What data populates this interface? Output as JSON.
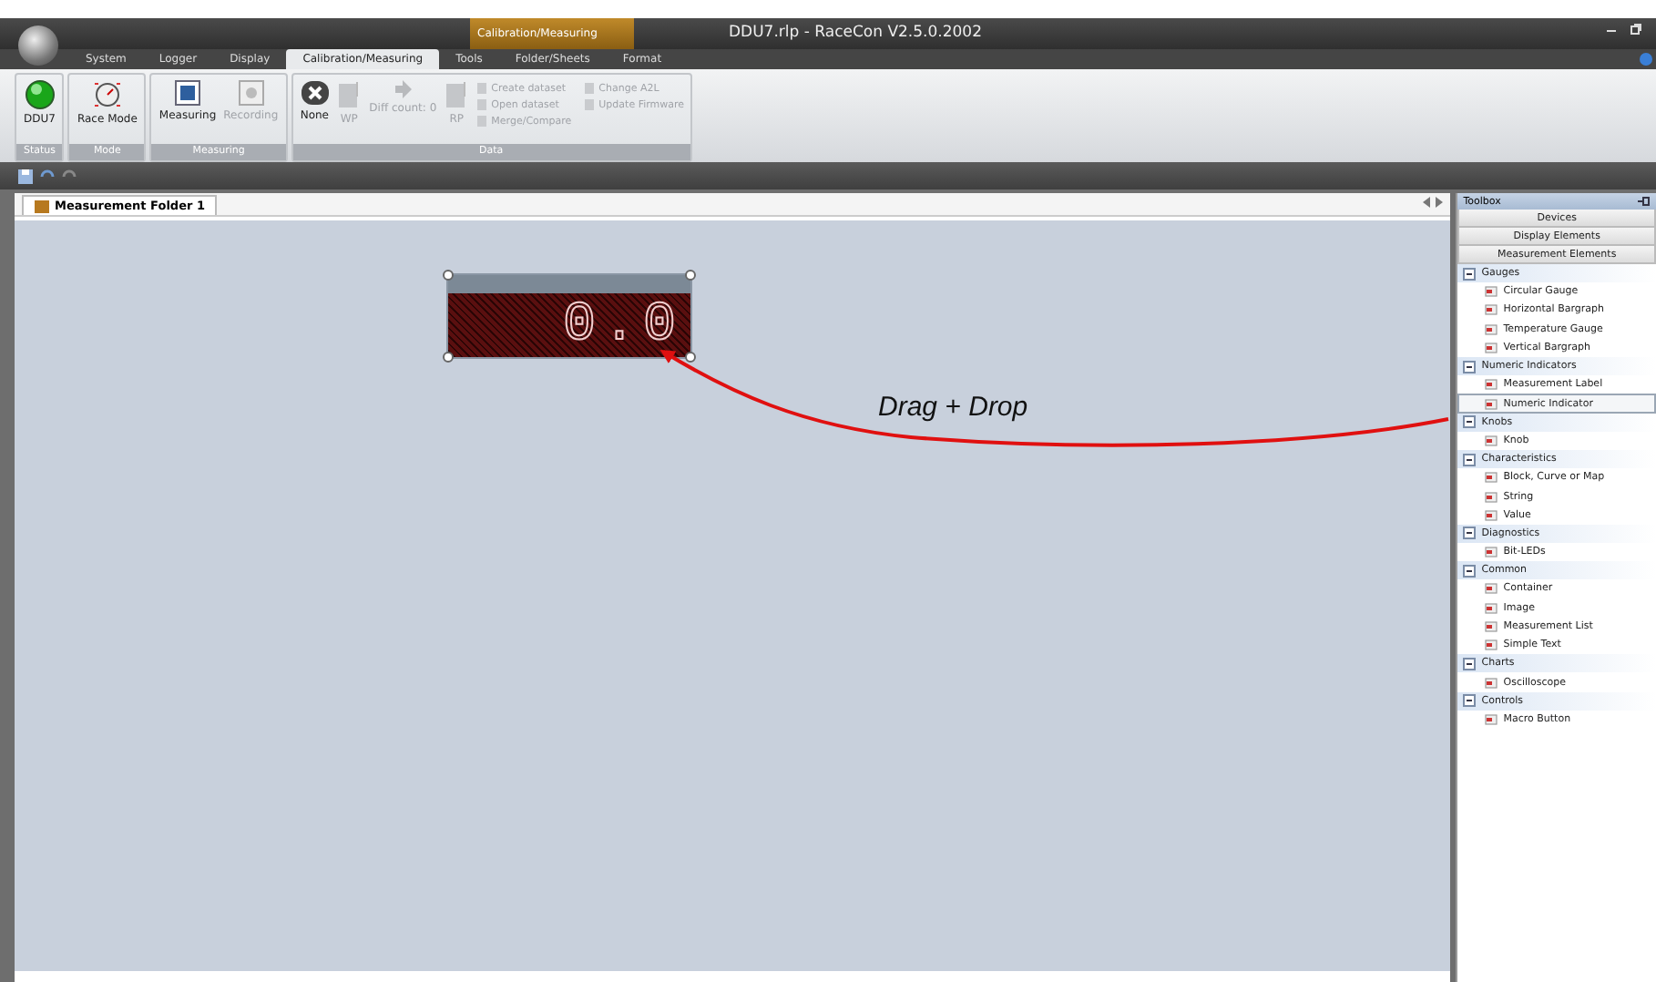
{
  "window": {
    "title": "DDU7.rlp - RaceCon V2.5.0.2002",
    "contextual_tab_group": "Calibration/Measuring"
  },
  "tabs": [
    {
      "label": "System",
      "selected": false
    },
    {
      "label": "Logger",
      "selected": false
    },
    {
      "label": "Display",
      "selected": false
    },
    {
      "label": "Calibration/Measuring",
      "selected": true
    },
    {
      "label": "Tools",
      "selected": false
    },
    {
      "label": "Folder/Sheets",
      "selected": false
    },
    {
      "label": "Format",
      "selected": false
    }
  ],
  "ribbon": [
    {
      "group": "Status",
      "buttons": [
        {
          "label": "DDU7",
          "kind": "led",
          "disabled": false
        }
      ]
    },
    {
      "group": "Mode",
      "buttons": [
        {
          "label": "Race Mode",
          "kind": "gauge",
          "disabled": false
        }
      ]
    },
    {
      "group": "Measuring",
      "buttons": [
        {
          "label": "Measuring",
          "kind": "square",
          "disabled": false
        },
        {
          "label": "Recording",
          "kind": "record",
          "disabled": true
        }
      ]
    },
    {
      "group": "Data",
      "buttons": [
        {
          "label": "None",
          "kind": "none",
          "disabled": false
        },
        {
          "label": "WP",
          "kind": "page",
          "disabled": true
        },
        {
          "label": "Diff count: 0",
          "kind": "diff",
          "disabled": true
        },
        {
          "label": "RP",
          "kind": "page",
          "disabled": true
        }
      ],
      "small_buttons": [
        {
          "label": "Create dataset",
          "disabled": true
        },
        {
          "label": "Open dataset",
          "disabled": true
        },
        {
          "label": "Merge/Compare",
          "disabled": true
        },
        {
          "label": "Change A2L",
          "disabled": true
        },
        {
          "label": "Update Firmware",
          "disabled": true
        }
      ]
    }
  ],
  "document_tab": {
    "label": "Measurement Folder 1"
  },
  "canvas": {
    "display_value": "0.0",
    "annotation": "Drag + Drop"
  },
  "toolbox": {
    "title": "Toolbox",
    "sections": [
      "Devices",
      "Display Elements",
      "Measurement Elements"
    ],
    "categories": [
      {
        "label": "Gauges",
        "expanded": true,
        "children": [
          {
            "label": "Circular Gauge",
            "selected": false
          },
          {
            "label": "Horizontal Bargraph",
            "selected": false
          },
          {
            "label": "Temperature Gauge",
            "selected": false
          },
          {
            "label": "Vertical Bargraph",
            "selected": false
          }
        ]
      },
      {
        "label": "Numeric Indicators",
        "expanded": true,
        "children": [
          {
            "label": "Measurement Label",
            "selected": false
          },
          {
            "label": "Numeric Indicator",
            "selected": true
          }
        ]
      },
      {
        "label": "Knobs",
        "expanded": true,
        "children": [
          {
            "label": "Knob",
            "selected": false
          }
        ]
      },
      {
        "label": "Characteristics",
        "expanded": true,
        "children": [
          {
            "label": "Block, Curve or Map",
            "selected": false
          },
          {
            "label": "String",
            "selected": false
          },
          {
            "label": "Value",
            "selected": false
          }
        ]
      },
      {
        "label": "Diagnostics",
        "expanded": true,
        "children": [
          {
            "label": "Bit-LEDs",
            "selected": false
          }
        ]
      },
      {
        "label": "Common",
        "expanded": true,
        "children": [
          {
            "label": "Container",
            "selected": false
          },
          {
            "label": "Image",
            "selected": false
          },
          {
            "label": "Measurement List",
            "selected": false
          },
          {
            "label": "Simple Text",
            "selected": false
          }
        ]
      },
      {
        "label": "Charts",
        "expanded": true,
        "children": [
          {
            "label": "Oscilloscope",
            "selected": false
          }
        ]
      },
      {
        "label": "Controls",
        "expanded": true,
        "children": [
          {
            "label": "Macro Button",
            "selected": false
          }
        ]
      }
    ]
  }
}
